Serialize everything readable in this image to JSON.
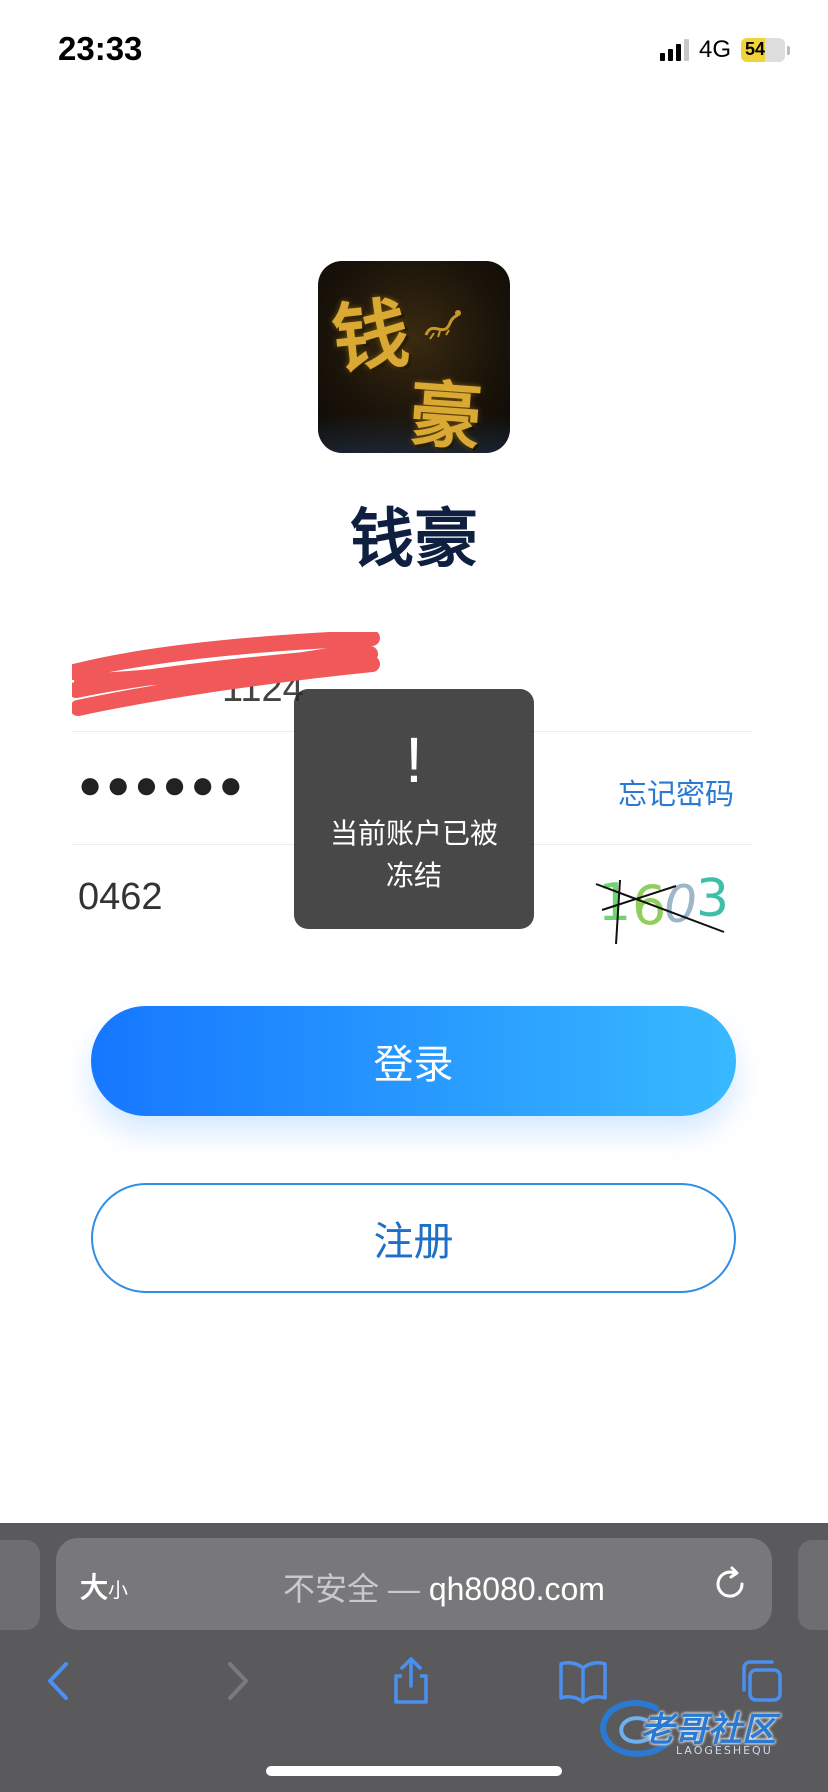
{
  "status_bar": {
    "time": "23:33",
    "network": "4G",
    "battery": "54",
    "battery_level": 0.54
  },
  "app": {
    "logo_chars": [
      "钱",
      "豪"
    ],
    "name": "钱豪"
  },
  "form": {
    "account_value": "1124",
    "password_value": "●●●●●●",
    "forgot_password": "忘记密码",
    "captcha_value": "0462",
    "captcha_image_text": "1603"
  },
  "toast": {
    "icon": "!",
    "message": "当前账户已被冻结"
  },
  "buttons": {
    "login": "登录",
    "register": "注册"
  },
  "browser": {
    "text_size_big": "大",
    "text_size_small": "小",
    "insecure_label": "不安全 — ",
    "domain": "qh8080.com"
  },
  "watermark": {
    "text": "老哥社区",
    "sub": "LAOGESHEQU"
  },
  "colors": {
    "primary": "#1677ff",
    "primary_end": "#38b9ff",
    "link": "#2a7ad3",
    "title": "#0e1f40"
  }
}
